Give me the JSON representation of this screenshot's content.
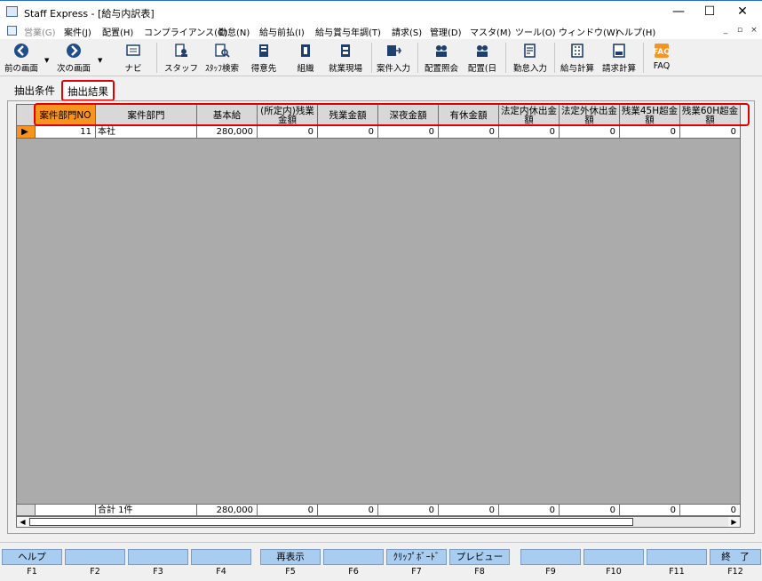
{
  "window": {
    "title": "Staff Express - [給与内訳表]",
    "minimize": "—",
    "maximize": "☐",
    "close": "✕"
  },
  "menu": [
    {
      "label": "営業(G)",
      "disabled": true
    },
    {
      "label": "案件(J)"
    },
    {
      "label": "配置(H)"
    },
    {
      "label": "コンプライアンス(C)"
    },
    {
      "label": "勤怠(N)"
    },
    {
      "label": "給与前払(I)"
    },
    {
      "label": "給与賞与年調(T)"
    },
    {
      "label": "請求(S)"
    },
    {
      "label": "管理(D)"
    },
    {
      "label": "マスタ(M)"
    },
    {
      "label": "ツール(O)"
    },
    {
      "label": "ウィンドウ(W)"
    },
    {
      "label": "ヘルプ(H)"
    }
  ],
  "mdi_buttons": [
    "_",
    "▫",
    "×"
  ],
  "toolbar": [
    {
      "label": "前の画面",
      "icon": "back-arrow-icon"
    },
    {
      "label": "次の画面",
      "icon": "forward-arrow-icon"
    },
    {
      "label": "ナビ",
      "icon": "navi-icon"
    },
    {
      "label": "スタッフ",
      "icon": "staff-icon"
    },
    {
      "label": "ｽﾀｯﾌ検索",
      "icon": "staff-search-icon"
    },
    {
      "label": "得意先",
      "icon": "client-icon"
    },
    {
      "label": "組織",
      "icon": "organization-icon"
    },
    {
      "label": "就業現場",
      "icon": "worksite-icon"
    },
    {
      "label": "案件入力",
      "icon": "job-input-icon"
    },
    {
      "label": "配置照会",
      "icon": "placement-inquiry-icon"
    },
    {
      "label": "配置(日",
      "icon": "placement-daily-icon"
    },
    {
      "label": "勤怠入力",
      "icon": "attendance-input-icon"
    },
    {
      "label": "給与計算",
      "icon": "payroll-icon"
    },
    {
      "label": "請求計算",
      "icon": "billing-icon"
    },
    {
      "label": "FAQ",
      "icon": "faq-icon"
    }
  ],
  "tabs": [
    "抽出条件",
    "抽出結果"
  ],
  "grid": {
    "columns": [
      "案件部門NO",
      "案件部門",
      "基本給",
      "(所定内)残業金額",
      "残業金額",
      "深夜金額",
      "有休金額",
      "法定内休出金額",
      "法定外休出金額",
      "残業45H超金額",
      "残業60H超金額"
    ],
    "rows": [
      [
        "11",
        "本社",
        "280,000",
        "0",
        "0",
        "0",
        "0",
        "0",
        "0",
        "0",
        "0"
      ]
    ],
    "footer": [
      "",
      "合計 1件",
      "280,000",
      "0",
      "0",
      "0",
      "0",
      "0",
      "0",
      "0",
      "0"
    ]
  },
  "fkeys": [
    {
      "label": "ヘルプ",
      "key": "F1"
    },
    {
      "label": "",
      "key": "F2"
    },
    {
      "label": "",
      "key": "F3"
    },
    {
      "label": "",
      "key": "F4"
    },
    {
      "label": "再表示",
      "key": "F5"
    },
    {
      "label": "",
      "key": "F6"
    },
    {
      "label": "ｸﾘｯﾌﾟﾎﾞｰﾄﾞ",
      "key": "F7"
    },
    {
      "label": "プレビュー",
      "key": "F8"
    },
    {
      "label": "",
      "key": "F9"
    },
    {
      "label": "",
      "key": "F10"
    },
    {
      "label": "",
      "key": "F11"
    },
    {
      "label": "終　了",
      "key": "F12"
    }
  ],
  "colors": {
    "selected_header": "#f7931e",
    "highlight_frame": "#e00000",
    "fkey_bg": "#a9cdf0",
    "grid_bg": "#ababab"
  }
}
